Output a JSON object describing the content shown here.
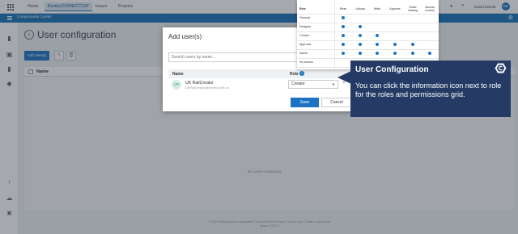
{
  "topnav": {
    "tabs": [
      {
        "label": "Home"
      },
      {
        "label": "BentleyCONNECTCAT"
      },
      {
        "label": "Issues"
      },
      {
        "label": "Projects"
      }
    ],
    "user_name": "David Detroit",
    "avatar_initials": "DD"
  },
  "bluebar": {
    "crumb": "Components Center"
  },
  "page": {
    "title": "User configuration",
    "add_users_label": "Add user(s)",
    "table_header_name": "Name",
    "empty_text": "No users configured...",
    "footer_line1": "© 2020 Bentley Systems, Incorporated | Terms of Service | Privacy | Terms of Use | Cookies | Legal notices",
    "footer_line2": "Version 0.28.31.0"
  },
  "modal": {
    "title": "Add user(s)",
    "search_placeholder": "Search users by name...",
    "col_name": "Name",
    "col_role": "Role",
    "user": {
      "initials": "UR",
      "name": "UK RailCreator",
      "email": "UKRailCreator@bentley-mdk.co"
    },
    "role_value": "Creator",
    "save_label": "Save",
    "cancel_label": "Cancel"
  },
  "role_grid": {
    "header_role": "Role",
    "columns": [
      "Read",
      "Upload",
      "Write",
      "Approve",
      "Share Catalog",
      "Access Control"
    ],
    "rows": [
      {
        "role": "General",
        "perms": [
          true,
          false,
          false,
          false,
          false,
          false
        ]
      },
      {
        "role": "Designer",
        "perms": [
          true,
          true,
          false,
          false,
          false,
          false
        ]
      },
      {
        "role": "Creator",
        "perms": [
          true,
          true,
          true,
          false,
          false,
          false
        ]
      },
      {
        "role": "Approver",
        "perms": [
          true,
          true,
          true,
          true,
          true,
          false
        ]
      },
      {
        "role": "Admin",
        "perms": [
          true,
          true,
          true,
          true,
          true,
          true
        ]
      },
      {
        "role": "No access",
        "perms": [
          false,
          false,
          false,
          false,
          false,
          false
        ]
      }
    ]
  },
  "callout": {
    "title": "User Configuration",
    "body": "You can click the information icon next to role for the roles and permissions grid."
  },
  "colors": {
    "accent": "#1d72c4",
    "bluebar": "#1773b8",
    "callout_bg": "#253b66"
  }
}
